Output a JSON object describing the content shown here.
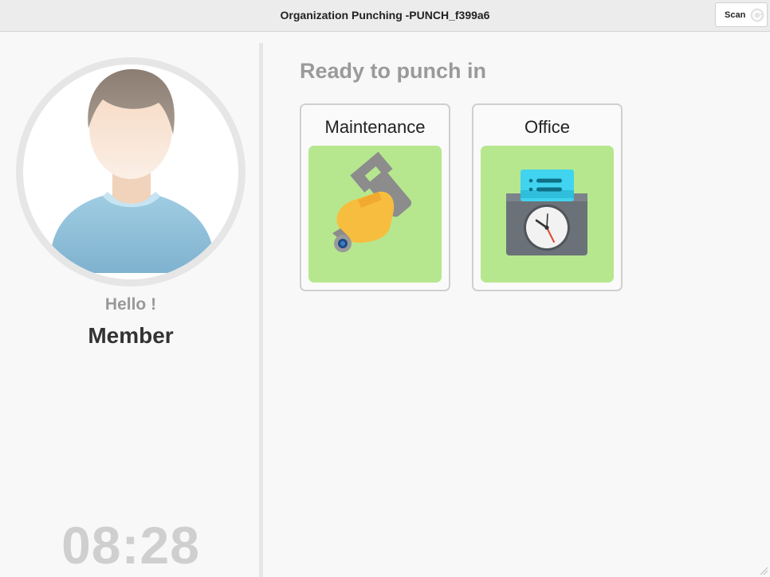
{
  "window": {
    "title": "Organization Punching -PUNCH_f399a6"
  },
  "toolbar": {
    "scan_label": "Scan"
  },
  "profile": {
    "greeting": "Hello !",
    "name": "Member"
  },
  "clock": {
    "time": "08:28"
  },
  "main": {
    "heading": "Ready to punch in",
    "options": [
      {
        "label": "Maintenance",
        "icon": "wrench-hand-icon"
      },
      {
        "label": "Office",
        "icon": "time-clock-icon"
      }
    ]
  },
  "colors": {
    "tile_green": "#b6e78f",
    "heading_gray": "#9a9a9a",
    "clock_gray": "#cfcfcf"
  }
}
